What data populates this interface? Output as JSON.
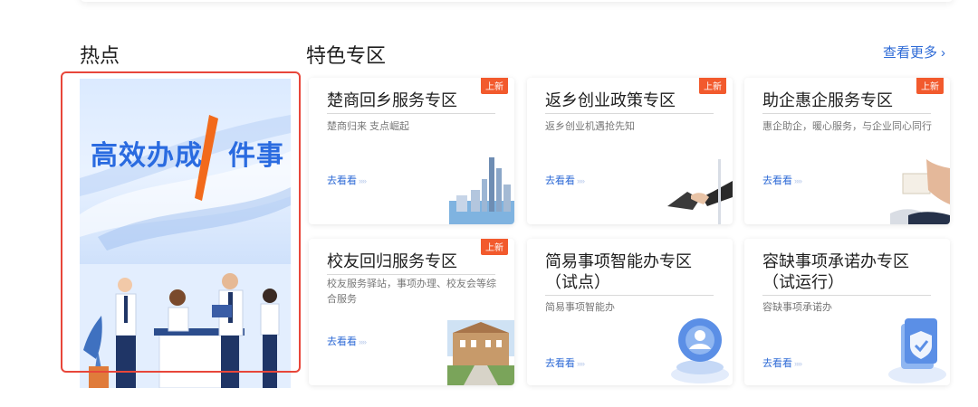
{
  "hot": {
    "title": "热点",
    "banner": {
      "heading_left": "高效办成",
      "heading_right": "件事"
    }
  },
  "featured": {
    "title": "特色专区",
    "more_label": "查看更多",
    "cards": [
      {
        "title": "楚商回乡服务专区",
        "desc": "楚商归来 支点崛起",
        "link": "去看看",
        "badge": "上新"
      },
      {
        "title": "返乡创业政策专区",
        "desc": "返乡创业机遇抢先知",
        "link": "去看看",
        "badge": "上新"
      },
      {
        "title": "助企惠企服务专区",
        "desc": "惠企助企，暖心服务，与企业同心同行",
        "link": "去看看",
        "badge": "上新"
      },
      {
        "title": "校友回归服务专区",
        "desc": "校友服务驿站，事项办理、校友会等综合服务",
        "link": "去看看",
        "badge": "上新"
      },
      {
        "title": "简易事项智能办专区（试点）",
        "desc": "简易事项智能办",
        "link": "去看看"
      },
      {
        "title": "容缺事项承诺办专区（试运行）",
        "desc": "容缺事项承诺办",
        "link": "去看看"
      }
    ]
  },
  "colors": {
    "accent": "#2d6ad6",
    "badge": "#f25a2d",
    "highlight": "#e8463a"
  },
  "icons": [
    "chevron-right-icon",
    "skyscraper-illustration",
    "handshake-illustration",
    "document-hands-illustration",
    "campus-building-illustration",
    "ai-avatar-illustration",
    "shield-document-illustration"
  ]
}
